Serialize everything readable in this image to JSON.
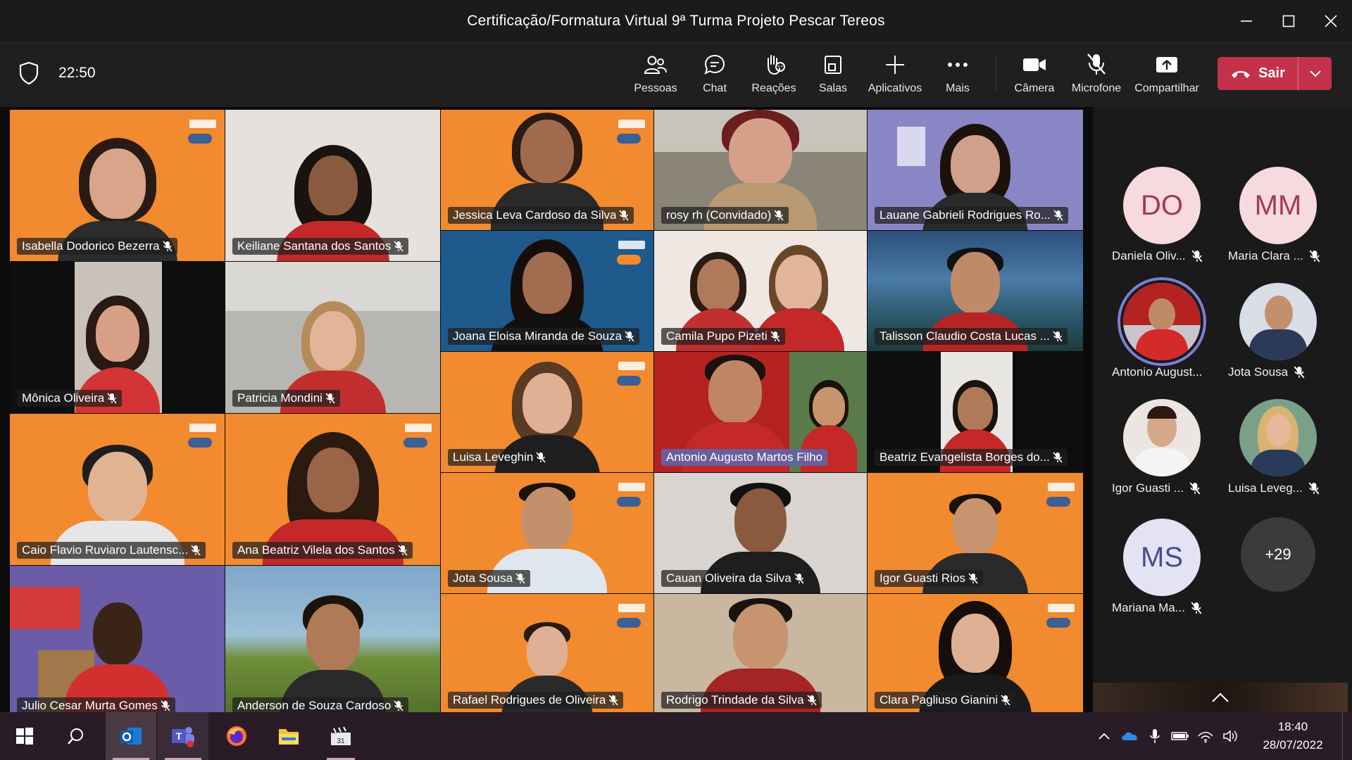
{
  "window": {
    "title": "Certificação/Formatura Virtual 9ª Turma Projeto Pescar Tereos"
  },
  "toolbar": {
    "time": "22:50",
    "items": [
      {
        "label": "Pessoas",
        "icon": "people-icon"
      },
      {
        "label": "Chat",
        "icon": "chat-icon"
      },
      {
        "label": "Reações",
        "icon": "raise-hand-icon"
      },
      {
        "label": "Salas",
        "icon": "breakout-rooms-icon"
      },
      {
        "label": "Aplicativos",
        "icon": "plus-icon"
      },
      {
        "label": "Mais",
        "icon": "more-icon"
      },
      {
        "label": "Câmera",
        "icon": "camera-icon"
      },
      {
        "label": "Microfone",
        "icon": "mic-off-icon"
      },
      {
        "label": "Compartilhar",
        "icon": "share-icon"
      }
    ],
    "leave_label": "Sair"
  },
  "tiles": [
    {
      "name": "Isabella Dodorico Bezerra"
    },
    {
      "name": "Keiliane Santana dos Santos"
    },
    {
      "name": "Jessica Leva Cardoso da Silva"
    },
    {
      "name": "rosy rh (Convidado)"
    },
    {
      "name": "Lauane Gabrieli Rodrigues Ro..."
    },
    {
      "name": "Joana Eloisa Miranda de Souza"
    },
    {
      "name": "Camila Pupo Pizeti"
    },
    {
      "name": "Talisson Claudio Costa Lucas ..."
    },
    {
      "name": "Mônica Oliveira"
    },
    {
      "name": "Patricia Mondini"
    },
    {
      "name": "Luisa Leveghin"
    },
    {
      "name": "Antonio Augusto Martos Filho"
    },
    {
      "name": "Beatriz Evangelista Borges do..."
    },
    {
      "name": "Caio Flavio Ruviaro Lautensc..."
    },
    {
      "name": "Ana Beatriz Vilela dos Santos"
    },
    {
      "name": "Jota Sousa"
    },
    {
      "name": "Cauan Oliveira da Silva"
    },
    {
      "name": "Igor Guasti Rios"
    },
    {
      "name": "Julio Cesar Murta Gomes"
    },
    {
      "name": "Anderson de Souza Cardoso"
    },
    {
      "name": "Rafael Rodrigues de Oliveira"
    },
    {
      "name": "Rodrigo Trindade da Silva"
    },
    {
      "name": "Clara Pagliuso Gianini"
    }
  ],
  "roster": [
    {
      "initials": "DO",
      "name": "Daniela Oliv...",
      "color": "#f7d9e0",
      "text": "#a13b55"
    },
    {
      "initials": "MM",
      "name": "Maria Clara ...",
      "color": "#f7d9e0",
      "text": "#a13b55"
    },
    {
      "initials": "",
      "name": "Antonio August...",
      "color": "#b82020",
      "text": "#fff"
    },
    {
      "initials": "",
      "name": "Jota Sousa",
      "color": "#d9dde6",
      "text": "#fff"
    },
    {
      "initials": "",
      "name": "Igor Guasti ...",
      "color": "#ece6e2",
      "text": "#fff"
    },
    {
      "initials": "",
      "name": "Luisa Leveg...",
      "color": "#7aa08a",
      "text": "#fff"
    },
    {
      "initials": "MS",
      "name": "Mariana Ma...",
      "color": "#e4e3f4",
      "text": "#4b4a8f"
    }
  ],
  "overflow_count": "+29",
  "taskbar": {
    "time": "18:40",
    "date": "28/07/2022"
  }
}
